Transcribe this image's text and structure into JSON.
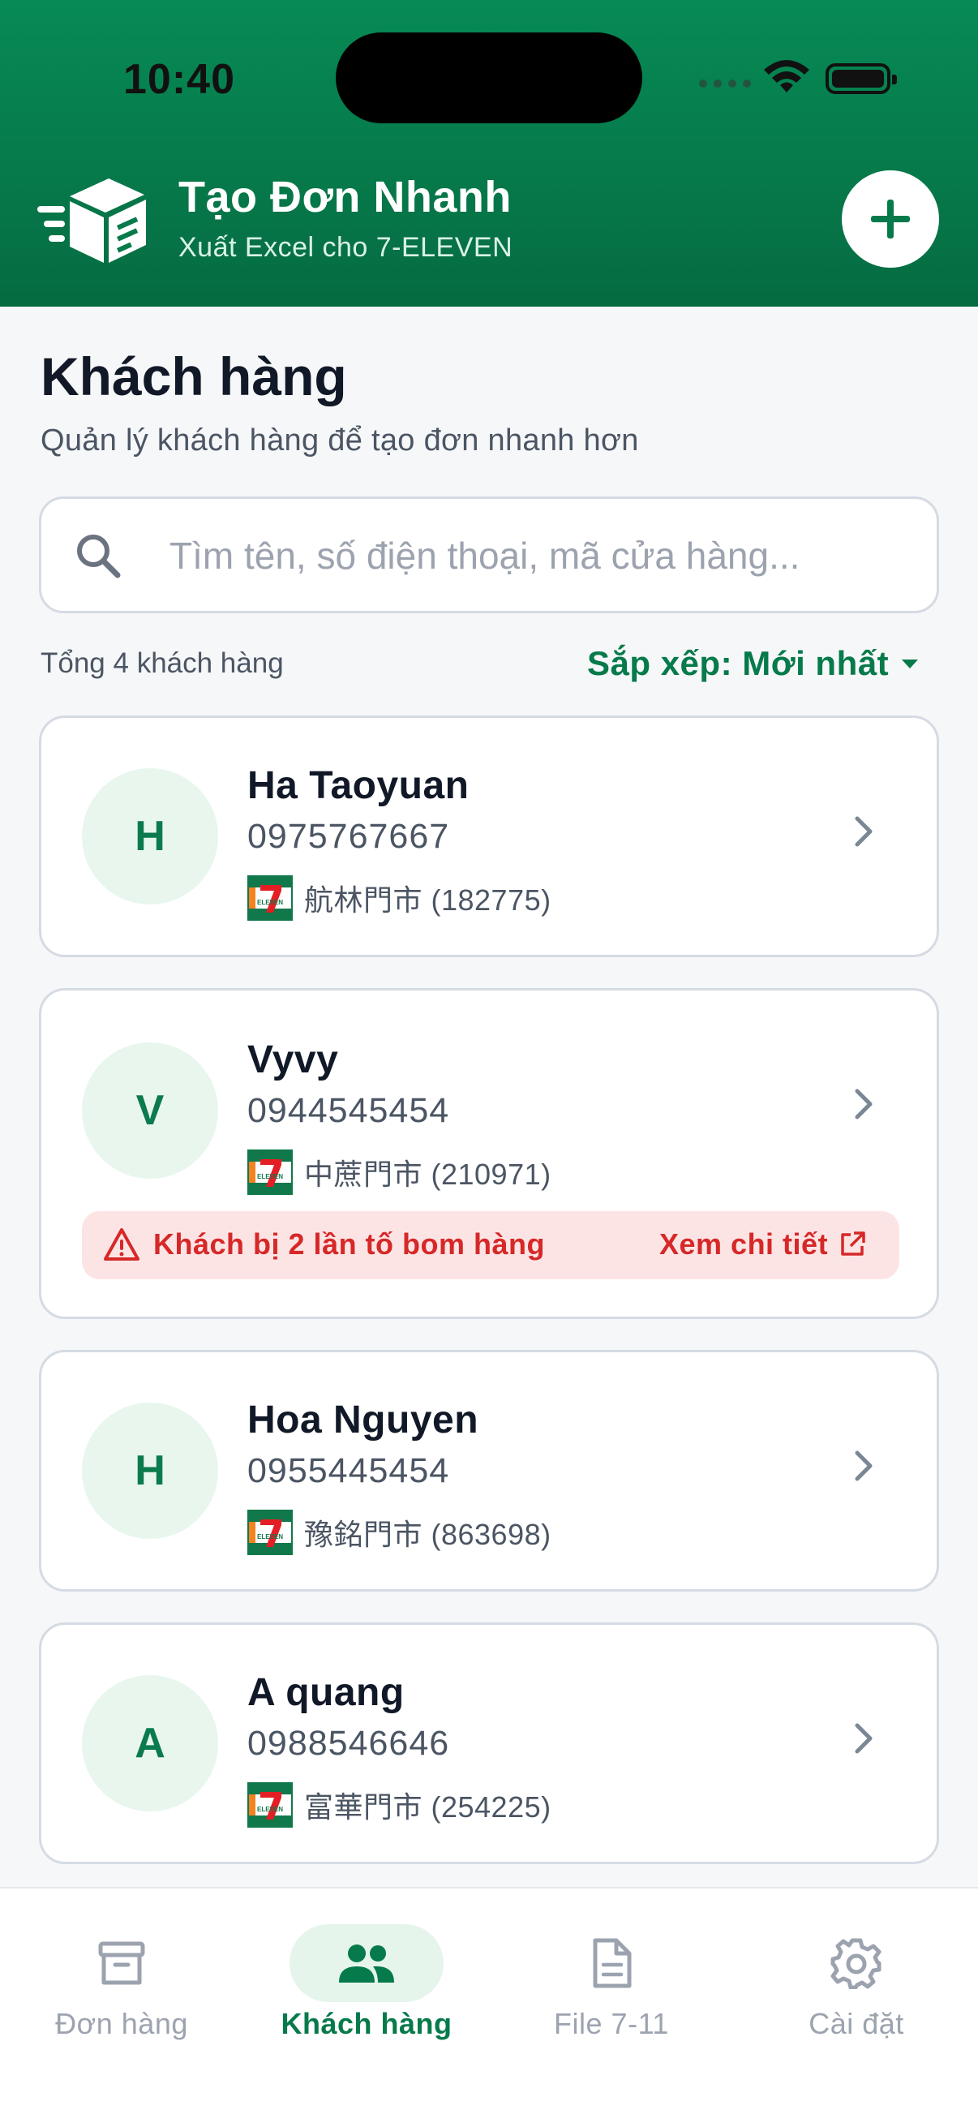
{
  "status_bar": {
    "time": "10:40"
  },
  "header": {
    "title": "Tạo Đơn Nhanh",
    "subtitle": "Xuất Excel cho 7-ELEVEN"
  },
  "page": {
    "title": "Khách hàng",
    "subtitle": "Quản lý khách hàng để tạo đơn nhanh hơn"
  },
  "search": {
    "placeholder": "Tìm tên, số điện thoại, mã cửa hàng..."
  },
  "summary": {
    "total_label": "Tổng 4 khách hàng",
    "sort_label": "Sắp xếp: Mới nhất"
  },
  "customers": [
    {
      "initial": "H",
      "name": "Ha Taoyuan",
      "phone": "0975767667",
      "store": "航林門市 (182775)"
    },
    {
      "initial": "V",
      "name": "Vyvy",
      "phone": "0944545454",
      "store": "中蔗門市 (210971)",
      "warning": {
        "text": "Khách bị 2 lần tố bom hàng",
        "link": "Xem chi tiết"
      }
    },
    {
      "initial": "H",
      "name": "Hoa Nguyen",
      "phone": "0955445454",
      "store": "豫銘門市 (863698)"
    },
    {
      "initial": "A",
      "name": "A quang",
      "phone": "0988546646",
      "store": "富華門市 (254225)"
    }
  ],
  "nav": [
    {
      "label": "Đơn hàng",
      "icon": "archive-icon",
      "active": false
    },
    {
      "label": "Khách hàng",
      "icon": "users-icon",
      "active": true
    },
    {
      "label": "File 7-11",
      "icon": "document-icon",
      "active": false
    },
    {
      "label": "Cài đặt",
      "icon": "gear-icon",
      "active": false
    }
  ],
  "colors": {
    "brand_green": "#067a4a",
    "avatar_bg": "#e8f6ee",
    "warning_red": "#d62828",
    "warning_bg": "#fde4e4"
  }
}
